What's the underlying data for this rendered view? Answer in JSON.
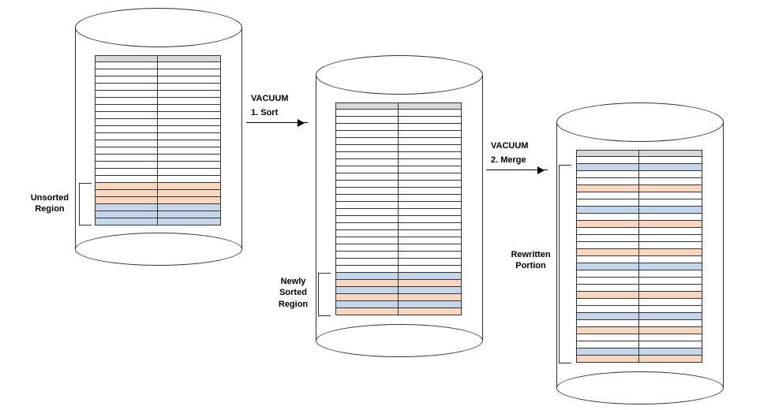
{
  "step1": {
    "op": "VACUUM",
    "action": "1. Sort"
  },
  "step2": {
    "op": "VACUUM",
    "action": "2. Merge"
  },
  "labels": {
    "unsorted": "Unsorted\nRegion",
    "newlySorted": "Newly\nSorted\nRegion",
    "rewritten": "Rewritten\nPortion"
  },
  "colors": {
    "grey": "#d8d8d8",
    "peach": "#f8d6bf",
    "blue": "#c5d6ea",
    "white": "#ffffff"
  },
  "cylinders": {
    "left": {
      "rows": [
        "grey",
        "white",
        "white",
        "white",
        "white",
        "white",
        "white",
        "white",
        "white",
        "white",
        "white",
        "white",
        "white",
        "white",
        "white",
        "white",
        "white",
        "white",
        "peach",
        "peach",
        "peach",
        "blue",
        "blue",
        "blue"
      ]
    },
    "middle": {
      "rows": [
        "grey",
        "white",
        "white",
        "white",
        "white",
        "white",
        "white",
        "white",
        "white",
        "white",
        "white",
        "white",
        "white",
        "white",
        "white",
        "white",
        "white",
        "white",
        "white",
        "white",
        "white",
        "white",
        "white",
        "white",
        "blue",
        "peach",
        "blue",
        "peach",
        "blue",
        "peach"
      ]
    },
    "right": {
      "rows": [
        "grey",
        "white",
        "blue",
        "white",
        "white",
        "peach",
        "white",
        "white",
        "blue",
        "white",
        "peach",
        "white",
        "white",
        "white",
        "peach",
        "white",
        "blue",
        "white",
        "white",
        "white",
        "peach",
        "white",
        "white",
        "blue",
        "white",
        "peach",
        "white",
        "white",
        "blue",
        "peach"
      ]
    }
  }
}
